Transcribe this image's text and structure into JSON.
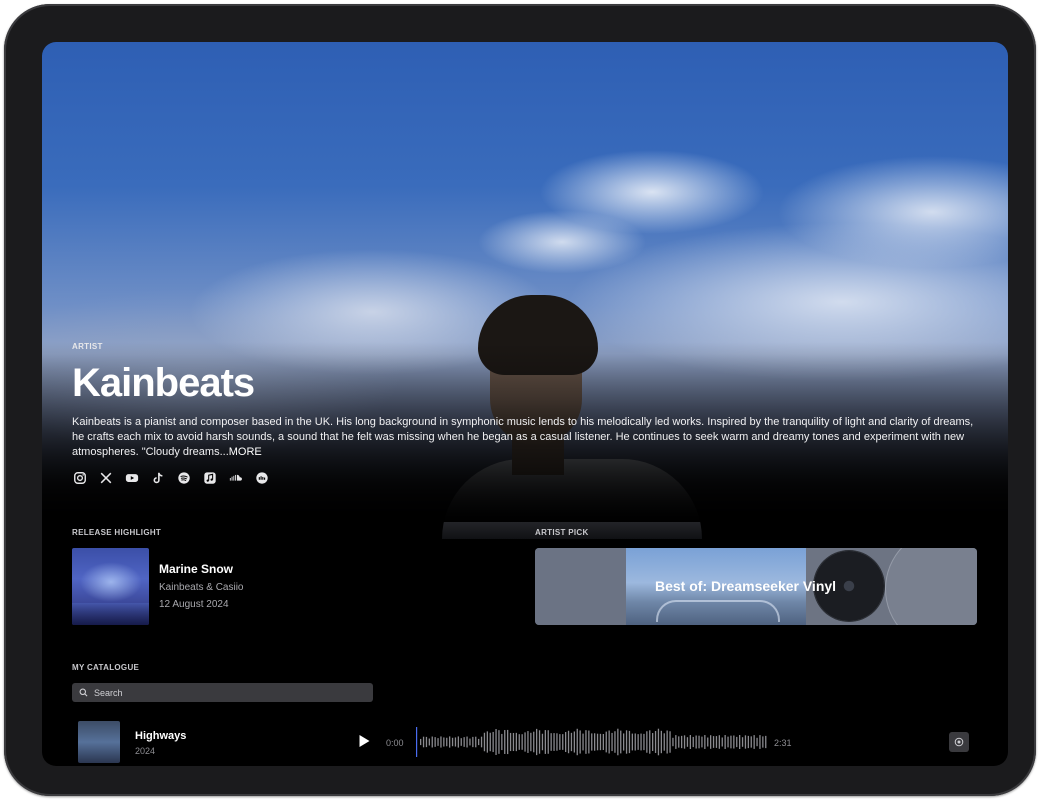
{
  "hero": {
    "eyebrow": "ARTIST",
    "name": "Kainbeats",
    "bio": "Kainbeats is a pianist and composer based in the UK. His long background in symphonic music lends to his melodically led works. Inspired by the tranquility of light and clarity of dreams, he crafts each mix to avoid harsh sounds, a sound that he felt was missing when he began as a casual listener. He continues to seek warm and dreamy tones and experiment with new atmospheres. \"Cloudy dreams...",
    "more_label": "MORE",
    "socials": [
      "instagram-icon",
      "x-icon",
      "youtube-icon",
      "tiktok-icon",
      "spotify-icon",
      "apple-music-icon",
      "soundcloud-icon",
      "deezer-icon"
    ]
  },
  "release_highlight": {
    "label": "RELEASE HIGHLIGHT",
    "title": "Marine Snow",
    "artists": "Kainbeats & Casiio",
    "date": "12 August 2024"
  },
  "artist_pick": {
    "label": "ARTIST PICK",
    "title": "Best of: Dreamseeker Vinyl"
  },
  "catalogue": {
    "label": "MY CATALOGUE",
    "search_placeholder": "Search",
    "tracks": [
      {
        "title": "Highways",
        "year": "2024",
        "current_time": "0:00",
        "duration": "2:31",
        "progress": 0
      }
    ]
  }
}
